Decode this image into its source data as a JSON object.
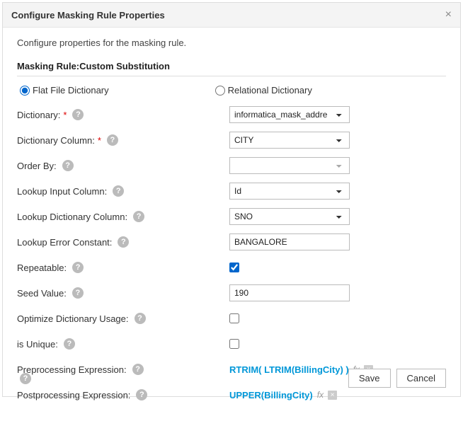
{
  "header": {
    "title": "Configure Masking Rule Properties"
  },
  "subtitle": "Configure properties for the masking rule.",
  "section_title": "Masking Rule:Custom Substitution",
  "dictionary_type": {
    "flat_file": {
      "label": "Flat File Dictionary",
      "checked": true
    },
    "relational": {
      "label": "Relational Dictionary",
      "checked": false
    }
  },
  "fields": {
    "dictionary": {
      "label": "Dictionary:",
      "required": true,
      "value": "informatica_mask_addre"
    },
    "dictionary_column": {
      "label": "Dictionary Column:",
      "required": true,
      "value": "CITY"
    },
    "order_by": {
      "label": "Order By:",
      "value": ""
    },
    "lookup_input_column": {
      "label": "Lookup Input Column:",
      "value": "Id"
    },
    "lookup_dictionary_column": {
      "label": "Lookup Dictionary Column:",
      "value": "SNO"
    },
    "lookup_error_constant": {
      "label": "Lookup Error Constant:",
      "value": "BANGALORE"
    },
    "repeatable": {
      "label": "Repeatable:",
      "checked": true
    },
    "seed_value": {
      "label": "Seed Value:",
      "value": "190"
    },
    "optimize_dictionary_usage": {
      "label": "Optimize Dictionary Usage:",
      "checked": false
    },
    "is_unique": {
      "label": "is Unique:",
      "checked": false
    },
    "preprocessing_expression": {
      "label": "Preprocessing Expression:",
      "value": "RTRIM( LTRIM(BillingCity) )"
    },
    "postprocessing_expression": {
      "label": "Postprocessing Expression:",
      "value": "UPPER(BillingCity)"
    }
  },
  "buttons": {
    "save": "Save",
    "cancel": "Cancel"
  },
  "fx_label": "fx"
}
